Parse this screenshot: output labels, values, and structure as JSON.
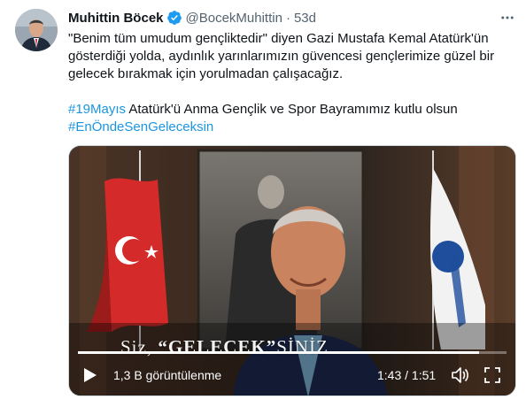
{
  "tweet": {
    "author_name": "Muhittin Böcek",
    "handle": "@BocekMuhittin",
    "separator": "·",
    "time": "53d",
    "text_lines": [
      "\"Benim tüm umudum gençliktedir\" diyen Gazi Mustafa Kemal Atatürk'ün",
      "gösterdiği yolda, aydınlık yarınlarımızın güvencesi gençlerimize güzel bir",
      "gelecek bırakmak için yorulmadan çalışacağız."
    ],
    "hashtag1": "#19Mayıs",
    "line4_rest": " Atatürk'ü Anma Gençlik ve Spor Bayramımız kutlu olsun",
    "hashtag2": "#EnÖndeSenGeleceksin"
  },
  "video": {
    "caption_prefix": "Siz, ",
    "caption_word": "“GELECEK”",
    "caption_suffix": "SİNİZ",
    "views": "1,3 B görüntülenme",
    "time_display": "1:43 / 1:51",
    "progress": 0.935
  },
  "icons": {
    "verified": "verified-badge-icon",
    "more": "more-icon",
    "play": "play-icon",
    "volume": "volume-icon",
    "fullscreen": "fullscreen-icon"
  },
  "colors": {
    "link": "#1b95e0",
    "verified": "#1d9bf0",
    "secondary_text": "#536471"
  }
}
